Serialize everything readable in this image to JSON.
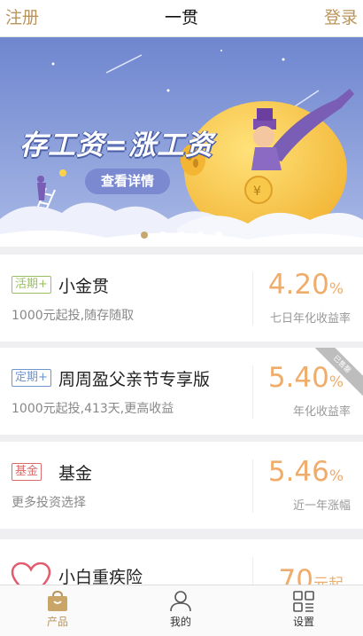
{
  "nav": {
    "left": "注册",
    "title": "一贯",
    "right": "登录"
  },
  "banner": {
    "headline": "存工资=涨工资",
    "button": "查看详情",
    "slides": 5,
    "active_slide": 1
  },
  "products": [
    {
      "tag": "活期+",
      "tag_color": "#9bbf63",
      "name": "小金贯",
      "desc": "1000元起投,随存随取",
      "rate": "4.20",
      "unit": "%",
      "rate_label": "七日年化收益率"
    },
    {
      "tag": "定期+",
      "tag_color": "#6f95cf",
      "name": "周周盈父亲节专享版",
      "desc": "1000元起投,413天,更高收益",
      "rate": "5.40",
      "unit": "%",
      "rate_label": "年化收益率",
      "ribbon": "已售罄"
    },
    {
      "tag": "基金",
      "tag_color": "#d96b6b",
      "name": "基金",
      "desc": "更多投资选择",
      "rate": "5.46",
      "unit": "%",
      "rate_label": "近一年涨幅"
    },
    {
      "tag": "保险",
      "tag_color": "#e35a6c",
      "name": "小白重疾险",
      "desc": "",
      "rate": "70",
      "unit": "元起",
      "rate_label": ""
    }
  ],
  "tabs": [
    {
      "label": "产品",
      "icon": "bag-icon",
      "active": true
    },
    {
      "label": "我的",
      "icon": "person-icon",
      "active": false
    },
    {
      "label": "设置",
      "icon": "grid-icon",
      "active": false
    }
  ],
  "colors": {
    "accent": "#b8955e",
    "rate": "#f0ac6a"
  }
}
